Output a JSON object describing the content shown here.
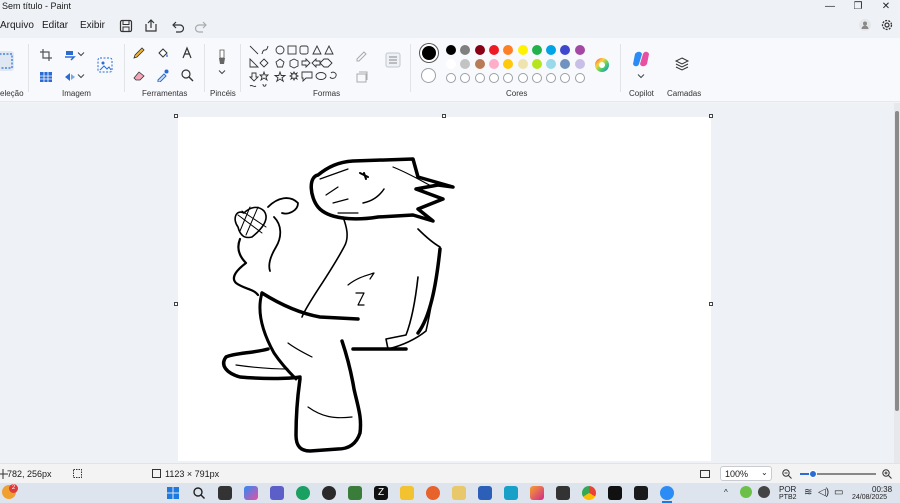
{
  "window": {
    "title": "Sem título - Paint"
  },
  "menu": {
    "file": "Arquivo",
    "edit": "Editar",
    "view": "Exibir"
  },
  "ribbon": {
    "groups": {
      "selection": "eleção",
      "image": "Imagem",
      "tools": "Ferramentas",
      "brushes": "Pincéis",
      "shapes": "Formas",
      "colors": "Cores",
      "copilot": "Copilot",
      "layers": "Camadas"
    },
    "colors_row1": [
      "#000000",
      "#7f7f7f",
      "#880015",
      "#ed1c24",
      "#ff7f27",
      "#fff200",
      "#22b14c",
      "#00a2e8",
      "#3f48cc",
      "#a349a4"
    ],
    "colors_row2": [
      "#ffffff",
      "#c3c3c3",
      "#b97a57",
      "#ffaec9",
      "#ffc90e",
      "#efe4b0",
      "#b5e61d",
      "#99d9ea",
      "#7092be",
      "#c8bfe7"
    ],
    "primary_color": "#000000",
    "secondary_color": "#ffffff"
  },
  "status": {
    "cursor_pos": "782, 256px",
    "canvas_size": "1123 × 791px",
    "zoom": "100%"
  },
  "taskbar": {
    "lang_top": "POR",
    "lang_bottom": "PTB2",
    "time": "00:38",
    "date": "24/08/2025",
    "notif_count": "2"
  },
  "icons": {
    "titlebar": [
      "minimize-icon",
      "restore-icon",
      "close-icon"
    ],
    "quick": [
      "save-icon",
      "share-icon",
      "undo-icon",
      "redo-icon"
    ]
  }
}
